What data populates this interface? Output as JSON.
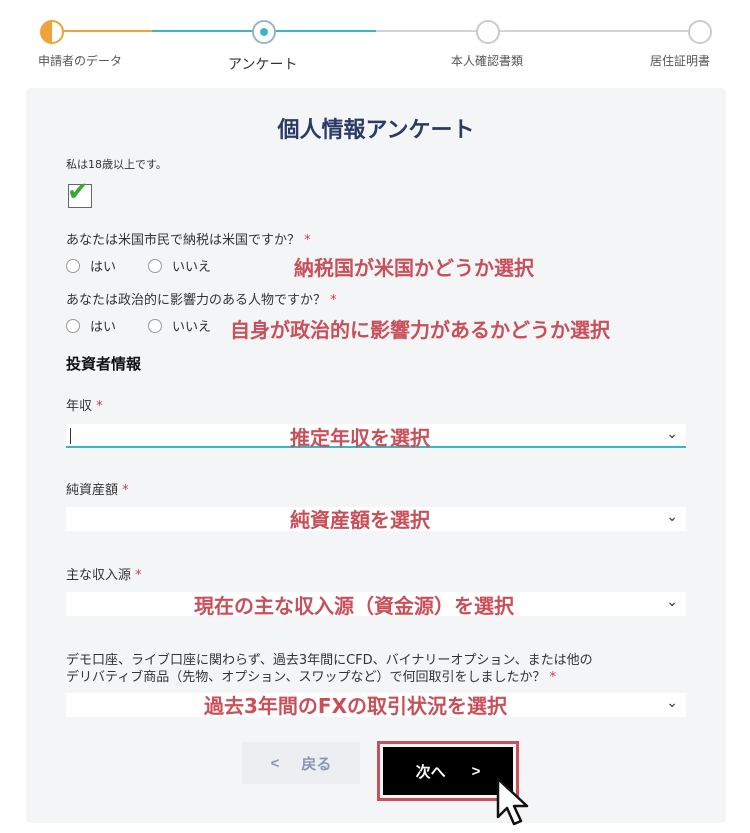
{
  "stepper": {
    "steps": [
      {
        "label": "申請者のデータ",
        "state": "done"
      },
      {
        "label": "アンケート",
        "state": "active"
      },
      {
        "label": "本人確認書類",
        "state": "pending"
      },
      {
        "label": "居住証明書",
        "state": "pending"
      }
    ]
  },
  "form": {
    "title": "個人情報アンケート",
    "age_label": "私は18歳以上です。",
    "us_question": "あなたは米国市民で納税は米国ですか？",
    "us_annotation": "納税国が米国かどうか選択",
    "pep_question": "あなたは政治的に影響力のある人物ですか？",
    "pep_annotation": "自身が政治的に影響力があるかどうか選択",
    "yes_label": "はい",
    "no_label": "いいえ",
    "required_mark": "*",
    "investor_section": "投資者情報",
    "income_label": "年収",
    "income_annotation": "推定年収を選択",
    "assets_label": "純資産額",
    "assets_annotation": "純資産額を選択",
    "source_label": "主な収入源",
    "source_annotation": "現在の主な収入源（資金源）を選択",
    "experience_line1": "デモ口座、ライブ口座に関わらず、過去3年間にCFD、バイナリーオプション、または他の",
    "experience_line2": "デリバティブ商品（先物、オプション、スワップなど）で何回取引をしましたか？",
    "experience_annotation": "過去3年間のFXの取引状況を選択",
    "chevron": "⌄",
    "back_arrow": "<",
    "back_label": "戻る",
    "next_label": "次へ",
    "next_arrow": ">"
  },
  "colors": {
    "accent_orange": "#f0a23a",
    "accent_teal": "#3bb7c4",
    "title_navy": "#2b3a67",
    "annotation_red": "#c8505a",
    "required_red": "#d9334f"
  }
}
